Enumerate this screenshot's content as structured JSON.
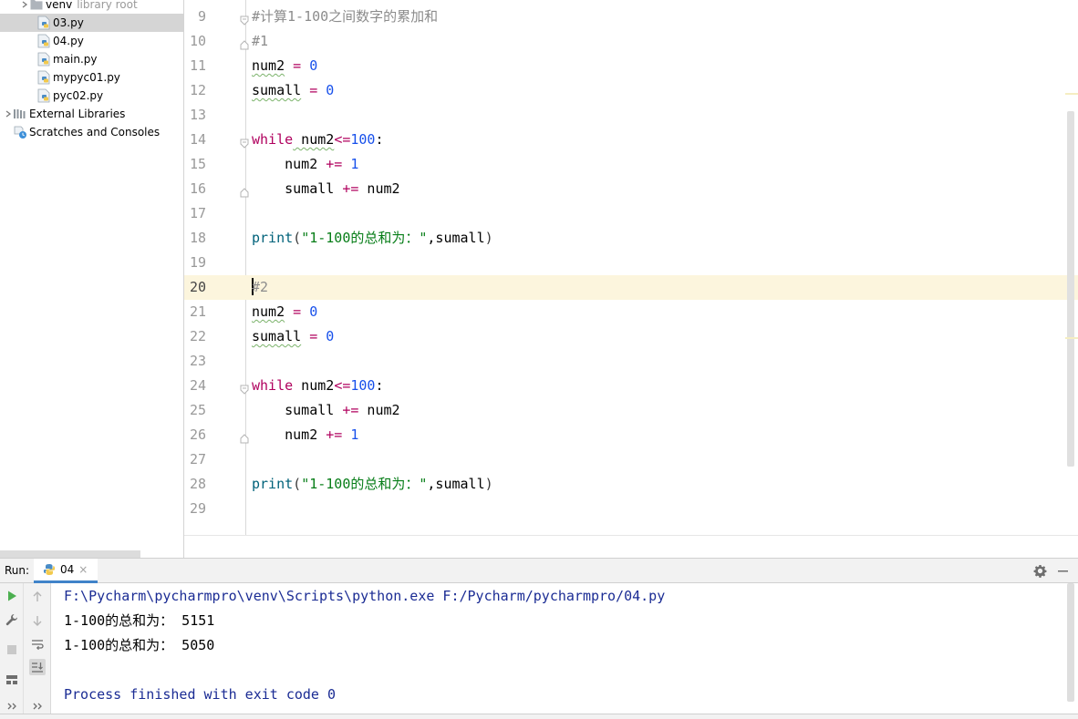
{
  "project_tree": {
    "items": [
      {
        "label": "venv",
        "hint": "library root",
        "kind": "folder",
        "expandable": true
      },
      {
        "label": "03.py",
        "kind": "py-file",
        "selected": true
      },
      {
        "label": "04.py",
        "kind": "py-file"
      },
      {
        "label": "main.py",
        "kind": "py-file"
      },
      {
        "label": "mypyc01.py",
        "kind": "py-file"
      },
      {
        "label": "pyc02.py",
        "kind": "py-file"
      },
      {
        "label": "External Libraries",
        "kind": "libraries",
        "expandable": true
      },
      {
        "label": "Scratches and Consoles",
        "kind": "scratches"
      }
    ]
  },
  "editor": {
    "current_line": "20",
    "lines": [
      {
        "num": "9",
        "tokens": [
          {
            "t": "#计算1-100之间数字的累加和",
            "c": "cm"
          }
        ],
        "fold": "top"
      },
      {
        "num": "10",
        "tokens": [
          {
            "t": "#1",
            "c": "cm"
          }
        ],
        "fold": "bottom"
      },
      {
        "num": "11",
        "tokens": [
          {
            "t": "num2",
            "c": "id",
            "squig": true
          },
          {
            "t": " = ",
            "c": "op"
          },
          {
            "t": "0",
            "c": "num"
          }
        ]
      },
      {
        "num": "12",
        "tokens": [
          {
            "t": "sumall",
            "c": "id",
            "squig": true
          },
          {
            "t": " = ",
            "c": "op"
          },
          {
            "t": "0",
            "c": "num"
          }
        ]
      },
      {
        "num": "13",
        "tokens": []
      },
      {
        "num": "14",
        "tokens": [
          {
            "t": "while",
            "c": "kw"
          },
          {
            "t": " num2",
            "c": "id",
            "squig": true
          },
          {
            "t": "<=",
            "c": "op"
          },
          {
            "t": "100",
            "c": "num"
          },
          {
            "t": ":",
            "c": "id"
          }
        ],
        "fold": "top"
      },
      {
        "num": "15",
        "tokens": [
          {
            "t": "    num2 ",
            "c": "id"
          },
          {
            "t": "+=",
            "c": "op"
          },
          {
            "t": " 1",
            "c": "num"
          }
        ]
      },
      {
        "num": "16",
        "tokens": [
          {
            "t": "    sumall ",
            "c": "id"
          },
          {
            "t": "+=",
            "c": "op"
          },
          {
            "t": " num2",
            "c": "id"
          }
        ],
        "fold": "bottom"
      },
      {
        "num": "17",
        "tokens": []
      },
      {
        "num": "18",
        "tokens": [
          {
            "t": "print",
            "c": "fn"
          },
          {
            "t": "(",
            "c": "paren"
          },
          {
            "t": "\"1-100的总和为：\"",
            "c": "str"
          },
          {
            "t": ",sumall",
            "c": "id"
          },
          {
            "t": ")",
            "c": "paren"
          }
        ]
      },
      {
        "num": "19",
        "tokens": []
      },
      {
        "num": "20",
        "tokens": [
          {
            "t": "#2",
            "c": "cm"
          }
        ],
        "caret": true
      },
      {
        "num": "21",
        "tokens": [
          {
            "t": "num2",
            "c": "id",
            "squig": true
          },
          {
            "t": " = ",
            "c": "op"
          },
          {
            "t": "0",
            "c": "num"
          }
        ]
      },
      {
        "num": "22",
        "tokens": [
          {
            "t": "sumall",
            "c": "id",
            "squig": true
          },
          {
            "t": " = ",
            "c": "op"
          },
          {
            "t": "0",
            "c": "num"
          }
        ]
      },
      {
        "num": "23",
        "tokens": []
      },
      {
        "num": "24",
        "tokens": [
          {
            "t": "while",
            "c": "kw"
          },
          {
            "t": " num2",
            "c": "id"
          },
          {
            "t": "<=",
            "c": "op"
          },
          {
            "t": "100",
            "c": "num"
          },
          {
            "t": ":",
            "c": "id"
          }
        ],
        "fold": "top"
      },
      {
        "num": "25",
        "tokens": [
          {
            "t": "    sumall ",
            "c": "id"
          },
          {
            "t": "+=",
            "c": "op"
          },
          {
            "t": " num2",
            "c": "id"
          }
        ]
      },
      {
        "num": "26",
        "tokens": [
          {
            "t": "    num2 ",
            "c": "id"
          },
          {
            "t": "+=",
            "c": "op"
          },
          {
            "t": " 1",
            "c": "num"
          }
        ],
        "fold": "bottom"
      },
      {
        "num": "27",
        "tokens": []
      },
      {
        "num": "28",
        "tokens": [
          {
            "t": "print",
            "c": "fn"
          },
          {
            "t": "(",
            "c": "paren"
          },
          {
            "t": "\"1-100的总和为：\"",
            "c": "str"
          },
          {
            "t": ",sumall",
            "c": "id"
          },
          {
            "t": ")",
            "c": "paren"
          }
        ]
      },
      {
        "num": "29",
        "tokens": []
      }
    ]
  },
  "run_panel": {
    "label": "Run:",
    "tab_label": "04",
    "tab_close": "×",
    "console": [
      {
        "text": "F:\\Pycharm\\pycharmpro\\venv\\Scripts\\python.exe F:/Pycharm/pycharmpro/04.py",
        "kind": "cmd"
      },
      {
        "text": "1-100的总和为： 5151",
        "kind": "out"
      },
      {
        "text": "1-100的总和为： 5050",
        "kind": "out"
      },
      {
        "text": "",
        "kind": "out"
      },
      {
        "text": "Process finished with exit code 0",
        "kind": "done"
      }
    ]
  },
  "colors": {
    "selection": "#d5d5d5",
    "current_line": "#fcf5dd",
    "keyword": "#b0005e",
    "number": "#1750eb",
    "string": "#067d17",
    "builtin": "#00627a",
    "console_system": "#1b2c94",
    "tab_underline": "#4083c9"
  }
}
